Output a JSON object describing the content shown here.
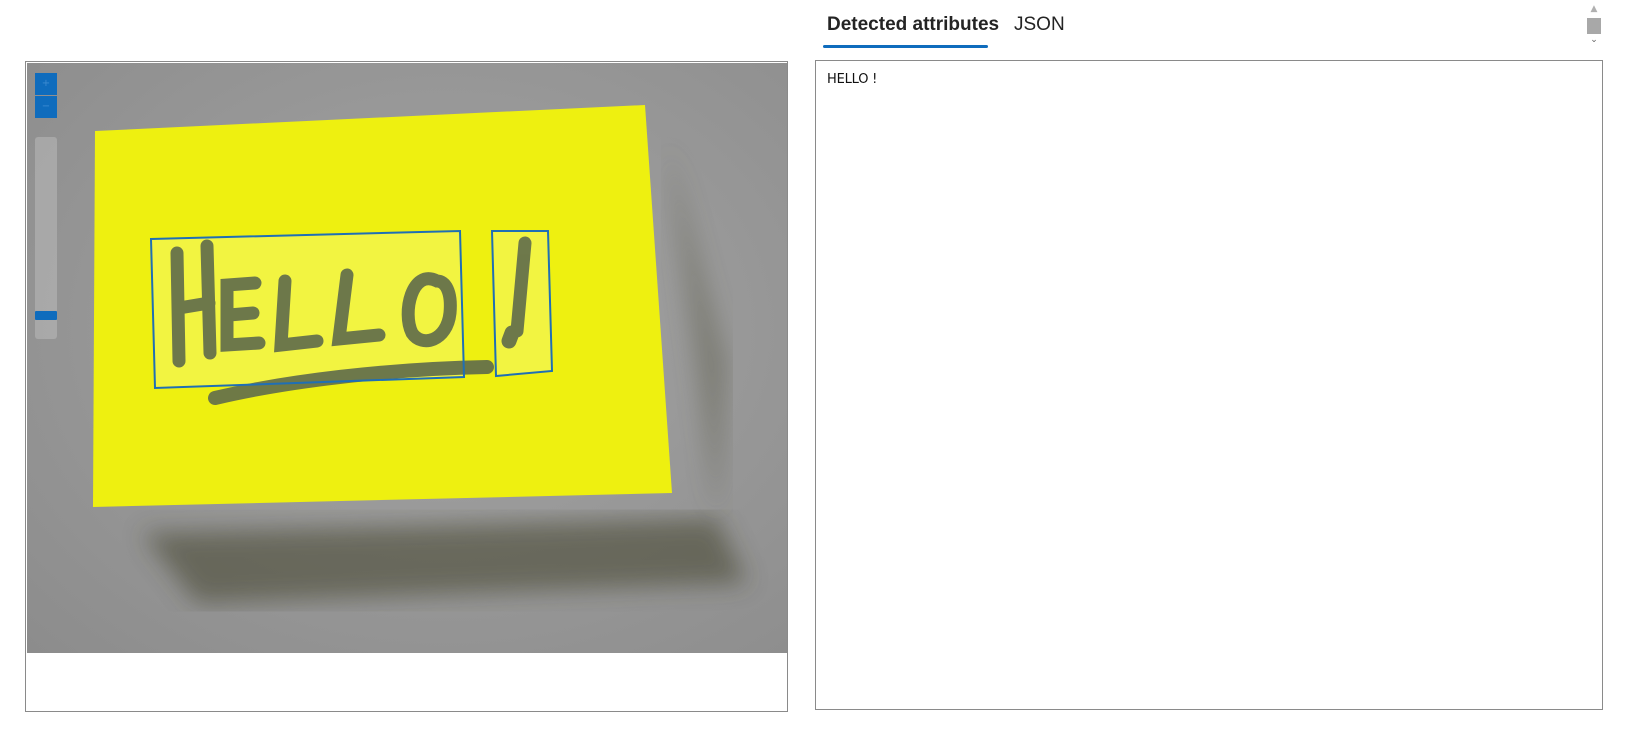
{
  "tabs": [
    {
      "label": "Detected attributes",
      "active": true
    },
    {
      "label": "JSON",
      "active": false
    }
  ],
  "result": {
    "text": "HELLO !"
  },
  "viewer": {
    "image": "sticky note with handwritten HELLO!",
    "zoom_in_icon": "plus-icon",
    "zoom_out_icon": "minus-icon",
    "detections": [
      {
        "label": "HELLO"
      },
      {
        "label": "!"
      }
    ]
  },
  "colors": {
    "accent": "#0f6cbd",
    "box_stroke": "#1f6fb5",
    "note": "#eef010",
    "ink": "#5c6a4a",
    "background": "#9a9a9a"
  }
}
